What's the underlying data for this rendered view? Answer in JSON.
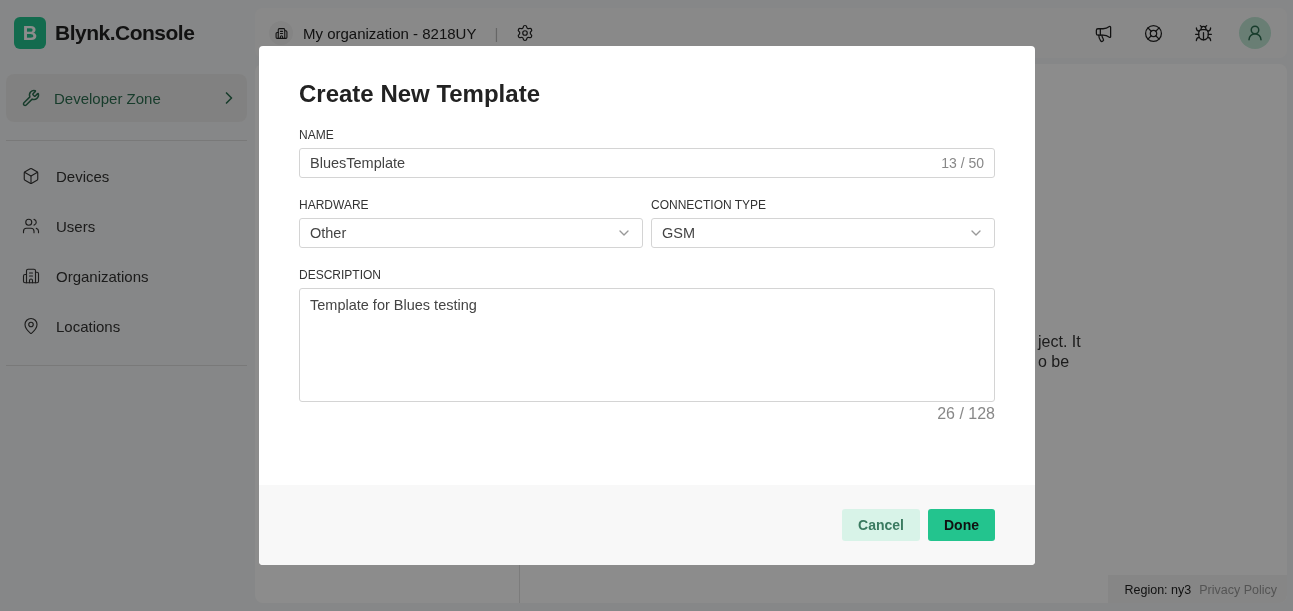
{
  "brand": {
    "logo_letter": "B",
    "name": "Blynk.Console"
  },
  "topbar": {
    "organization": "My organization - 8218UY",
    "separator": "|"
  },
  "sidebar": {
    "zone": {
      "label": "Developer Zone"
    },
    "items": [
      {
        "label": "Devices"
      },
      {
        "label": "Users"
      },
      {
        "label": "Organizations"
      },
      {
        "label": "Locations"
      }
    ]
  },
  "background_text": [
    "ject. It",
    "o be"
  ],
  "footer": {
    "region": "Region: ny3",
    "privacy": "Privacy Policy"
  },
  "dialog": {
    "title": "Create New Template",
    "name": {
      "label": "NAME",
      "value": "BluesTemplate",
      "counter": "13 / 50"
    },
    "hardware": {
      "label": "HARDWARE",
      "value": "Other"
    },
    "connection": {
      "label": "CONNECTION TYPE",
      "value": "GSM"
    },
    "description": {
      "label": "DESCRIPTION",
      "value": "Template for Blues testing",
      "counter": "26 / 128"
    },
    "buttons": [
      {
        "label": "Cancel",
        "kind": "secondary"
      },
      {
        "label": "Done",
        "kind": "primary"
      }
    ]
  }
}
